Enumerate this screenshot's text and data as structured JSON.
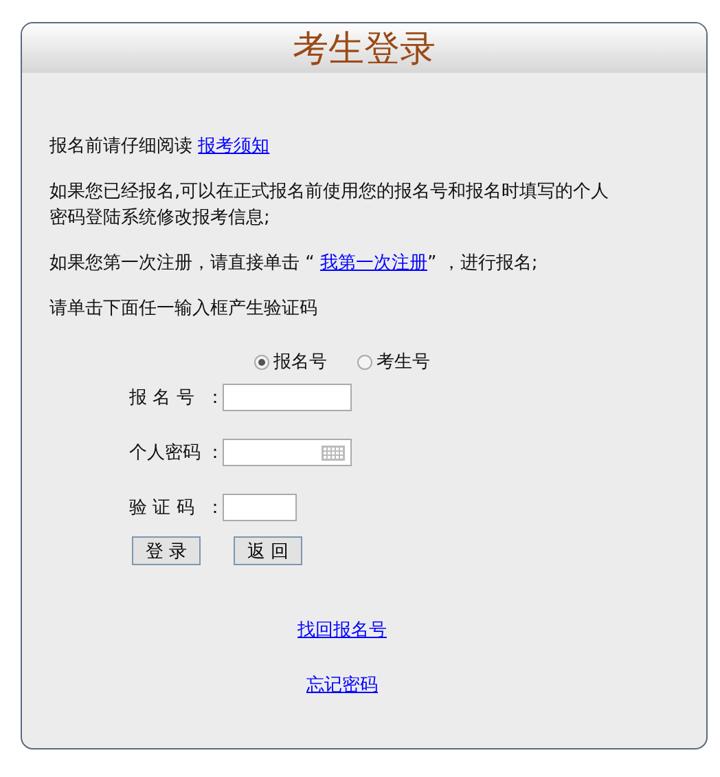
{
  "title": "考生登录",
  "notices": [
    {
      "before": "报名前请仔细阅读 ",
      "link": "报考须知"
    },
    {
      "before": "如果您已经报名,可以在正式报名前使用您的报名号和报名时填写的个人密码登陆系统修改报考信息;"
    },
    {
      "before": "如果您第一次注册，请直接单击 “ ",
      "link": "我第一次注册",
      "after": "” ，进行报名;"
    },
    {
      "before": "请单击下面任一输入框产生验证码"
    }
  ],
  "id_type": [
    {
      "label": "报名号",
      "selected": true
    },
    {
      "label": "考生号",
      "selected": false
    }
  ],
  "fields": [
    {
      "label": "报 名 号",
      "colon": "：",
      "kind": "text"
    },
    {
      "label": "个人密码",
      "colon": "：",
      "kind": "password"
    },
    {
      "label": "验 证 码",
      "colon": "：",
      "kind": "captcha"
    }
  ],
  "buttons": [
    "登 录",
    "返 回"
  ],
  "links": [
    "找回报名号",
    "忘记密码"
  ]
}
